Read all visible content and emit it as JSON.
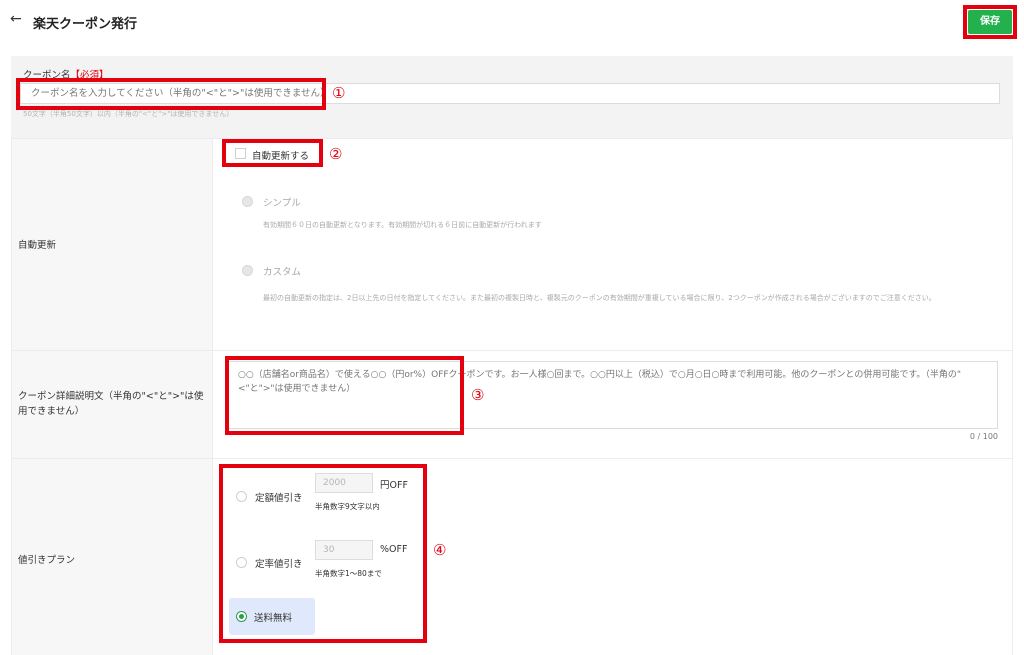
{
  "header": {
    "back_icon": "←",
    "title": "楽天クーポン発行",
    "save_label": "保存",
    "save_color": "#22b14c"
  },
  "coupon_name": {
    "label": "クーポン名",
    "required": "【必須】",
    "placeholder": "クーポン名を入力してください（半角の\"<\"と\">\"は使用できません）",
    "hint": "50文字（半角50文字）以内（半角の\"<\"と\">\"は使用できません）",
    "marker": "①"
  },
  "auto_renew": {
    "section_label": "自動更新",
    "checkbox_label": "自動更新する",
    "marker": "②",
    "simple_label": "シンプル",
    "simple_desc": "有効期間６０日の自動更新となります。有効期間が切れる６日前に自動更新が行われます",
    "custom_label": "カスタム",
    "custom_desc": "最初の自動更新の指定は、2日以上先の日付を指定してください。また最初の複製日時と、複製元のクーポンの有効期間が重複している場合に限り、2つクーポンが作成される場合がございますのでご注意ください。"
  },
  "description": {
    "section_label": "クーポン詳細説明文（半角の\"<\"と\">\"は使用できません）",
    "placeholder": "○○（店舗名or商品名）で使える○○（円or%）OFFクーポンです。お一人様○回まで。○○円以上（税込）で○月○日○時まで利用可能。他のクーポンとの併用可能です。（半角の\"<\"と\">\"は使用できません）",
    "counter": "0 / 100",
    "marker": "③"
  },
  "discount": {
    "section_label": "値引きプラン",
    "marker": "④",
    "fixed_label": "定額値引き",
    "fixed_value": "2000",
    "fixed_unit": "円OFF",
    "fixed_hint": "半角数字9文字以内",
    "rate_label": "定率値引き",
    "rate_value": "30",
    "rate_unit": "%OFF",
    "rate_hint": "半角数字1～80まで",
    "free_shipping_label": "送料無料",
    "selected": "送料無料"
  },
  "colors": {
    "annotation": "#e3000f",
    "accent_green": "#2a9d4c",
    "selected_bg": "#dfe9fb"
  }
}
